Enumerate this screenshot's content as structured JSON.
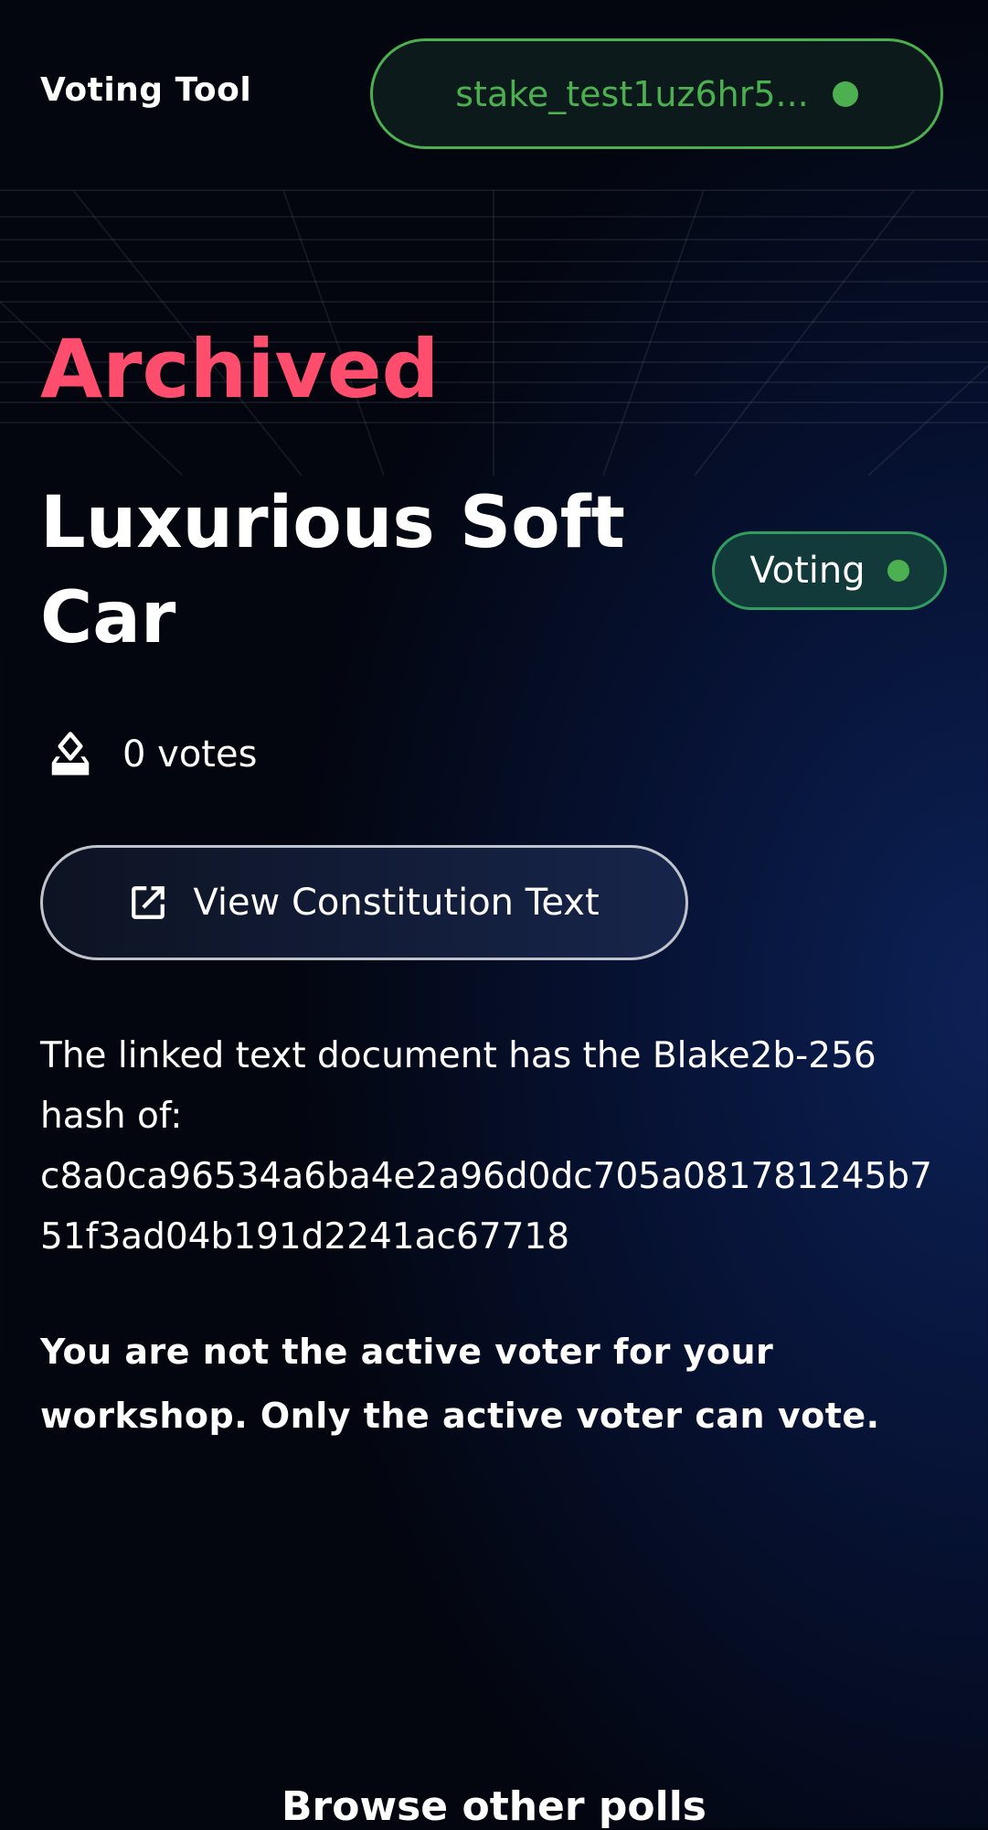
{
  "header": {
    "brand": "Voting Tool",
    "wallet_address": "stake_test1uz6hr5...",
    "wallet_status_color": "#4caf50"
  },
  "poll": {
    "state": "Archived",
    "state_color": "#ff4d6d",
    "title": "Luxurious Soft Car",
    "status_badge": "Voting",
    "votes": "0 votes",
    "view_button": "View Constitution Text",
    "hash_intro": "The linked text document has the Blake2b-256 hash of:",
    "hash": "c8a0ca96534a6ba4e2a96d0dc705a081781245b751f3ad04b191d2241ac67718",
    "notice": "You are not the active voter for your workshop. Only the active voter can vote."
  },
  "footer": {
    "browse_link": "Browse other polls"
  },
  "icons": {
    "votes": "ballot-box-icon",
    "view_button": "external-link-icon"
  }
}
